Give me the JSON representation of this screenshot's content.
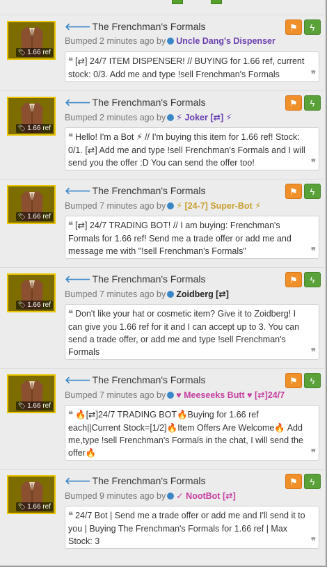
{
  "colors": {
    "tile_bg": "#7d6d00",
    "tile_border": "#e9c500",
    "flag_button": "#f0902a",
    "bolt_button": "#5ba13a",
    "title_arrow": "#3a87c8",
    "user_purple": "#6a3fb0",
    "user_gold": "#c8a030",
    "user_magenta": "#c63fa0"
  },
  "listings": [
    {
      "title": "The Frenchman's Formals",
      "price": "1.66 ref",
      "bumped_text": "Bumped 2 minutes ago by",
      "user": "Uncle Dang's Dispenser",
      "message": "[⇄] 24/7 ITEM DISPENSER! // BUYING for 1.66 ref, current stock: 0/3. Add me and type !sell Frenchman's Formals"
    },
    {
      "title": "The Frenchman's Formals",
      "price": "1.66 ref",
      "bumped_text": "Bumped 2 minutes ago by",
      "user": "⚡ Joker [⇄] ⚡",
      "message": "Hello! I'm a Bot ⚡ // I'm buying this item for 1.66 ref! Stock: 0/1. [⇄] Add me and type !sell Frenchman's Formals and I will send you the offer :D You can send the offer too!"
    },
    {
      "title": "The Frenchman's Formals",
      "price": "1.66 ref",
      "bumped_text": "Bumped 7 minutes ago by",
      "user": "⚡ [24-7] Super-Bot ⚡",
      "message": "[⇄] 24/7 TRADING BOT! // I am buying: Frenchman's Formals for 1.66 ref! Send me a trade offer or add me and message me with \"!sell Frenchman's Formals\""
    },
    {
      "title": "The Frenchman's Formals",
      "price": "1.66 ref",
      "bumped_text": "Bumped 7 minutes ago by",
      "user": "Zoidberg [⇄]",
      "message": "Don't like your hat or cosmetic item? Give it to Zoidberg! I can give you 1.66 ref for it and I can accept up to 3. You can send a trade offer, or add me and type !sell Frenchman's Formals"
    },
    {
      "title": "The Frenchman's Formals",
      "price": "1.66 ref",
      "bumped_text": "Bumped 7 minutes ago by",
      "user": "♥ Meeseeks Butt ♥ [⇄]24/7",
      "message": "🔥[⇄]24/7 TRADING BOT🔥Buying for 1.66 ref each||Current Stock=[1/2]🔥Item Offers Are Welcome🔥 Add me,type !sell Frenchman's Formals in the chat, I will send the offer🔥"
    },
    {
      "title": "The Frenchman's Formals",
      "price": "1.66 ref",
      "bumped_text": "Bumped 9 minutes ago by",
      "user": "✓ NootBot [⇄]",
      "message": "24/7 Bot | Send me a trade offer or add me and I'll send it to you | Buying The Frenchman's Formals for 1.66 ref | Max Stock: 3"
    }
  ]
}
